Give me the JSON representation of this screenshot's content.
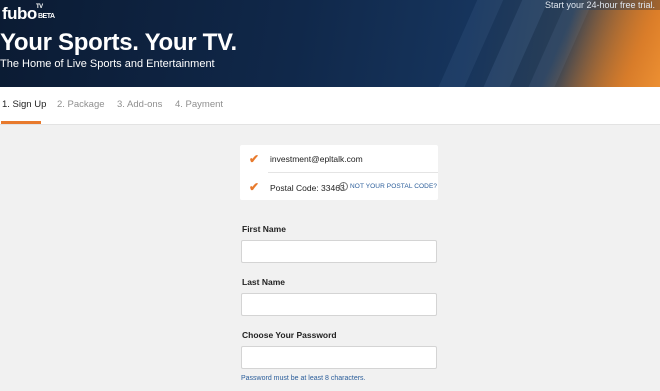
{
  "header": {
    "logo": "fubo",
    "logo_tv": "TV",
    "logo_badge": "BETA",
    "title": "Your Sports. Your TV.",
    "subtitle": "The Home of Live Sports and Entertainment",
    "trial": "Start your 24-hour free trial."
  },
  "steps": [
    {
      "label": "1. Sign Up",
      "active": true
    },
    {
      "label": "2. Package",
      "active": false
    },
    {
      "label": "3. Add-ons",
      "active": false
    },
    {
      "label": "4. Payment",
      "active": false
    }
  ],
  "confirmation": {
    "email": "investment@epltalk.com",
    "postal": "Postal Code: 33463",
    "postal_link": "NOT YOUR POSTAL CODE?",
    "check_icon": "checkmark-icon",
    "info_icon": "info-icon"
  },
  "form": {
    "first_name_label": "First Name",
    "first_name_value": "",
    "last_name_label": "Last Name",
    "last_name_value": "",
    "password_label": "Choose Your Password",
    "password_value": "",
    "password_hint": "Password must be at least 8 characters."
  },
  "colors": {
    "accent": "#e87a2d",
    "link": "#2a5d9a",
    "header_dark": "#0b1b33"
  }
}
